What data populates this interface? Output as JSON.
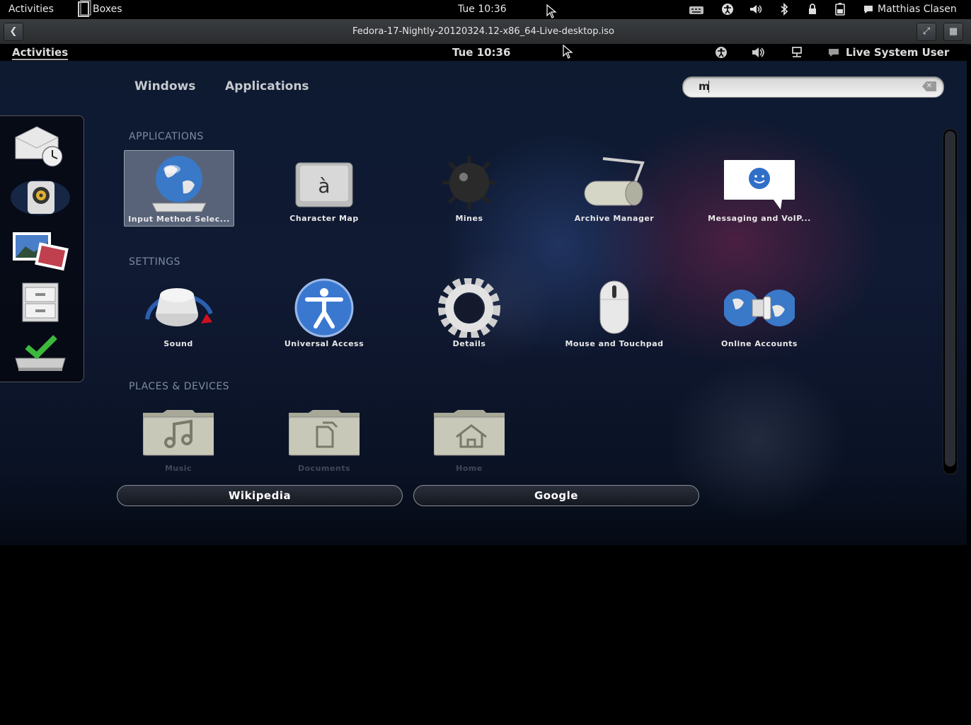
{
  "host_bar": {
    "activities": "Activities",
    "app_name": "Boxes",
    "clock": "Tue 10:36",
    "user": "Matthias Clasen"
  },
  "boxes_bar": {
    "title": "Fedora-17-Nightly-20120324.12-x86_64-Live-desktop.iso"
  },
  "guest_bar": {
    "activities": "Activities",
    "clock": "Tue 10:36",
    "user": "Live System User"
  },
  "overview": {
    "tabs": [
      "Windows",
      "Applications"
    ],
    "search": {
      "value": "m"
    }
  },
  "sections": {
    "applications": "APPLICATIONS",
    "settings": "SETTINGS",
    "places": "PLACES & DEVICES"
  },
  "applications": [
    {
      "label": "Input Method Selec...",
      "icon": "globe-keyboard-icon"
    },
    {
      "label": "Character Map",
      "icon": "character-map-icon"
    },
    {
      "label": "Mines",
      "icon": "mine-icon"
    },
    {
      "label": "Archive Manager",
      "icon": "archive-roller-icon"
    },
    {
      "label": "Messaging and VoIP...",
      "icon": "chat-bubble-icon"
    }
  ],
  "settings": [
    {
      "label": "Sound",
      "icon": "volume-knob-icon"
    },
    {
      "label": "Universal Access",
      "icon": "accessibility-icon"
    },
    {
      "label": "Details",
      "icon": "gear-icon"
    },
    {
      "label": "Mouse and Touchpad",
      "icon": "mouse-icon"
    },
    {
      "label": "Online Accounts",
      "icon": "online-accounts-icon"
    }
  ],
  "places": [
    {
      "label": "Music",
      "icon": "music-folder-icon"
    },
    {
      "label": "Documents",
      "icon": "documents-folder-icon"
    },
    {
      "label": "Home",
      "icon": "home-folder-icon"
    }
  ],
  "search_providers": [
    "Wikipedia",
    "Google"
  ]
}
